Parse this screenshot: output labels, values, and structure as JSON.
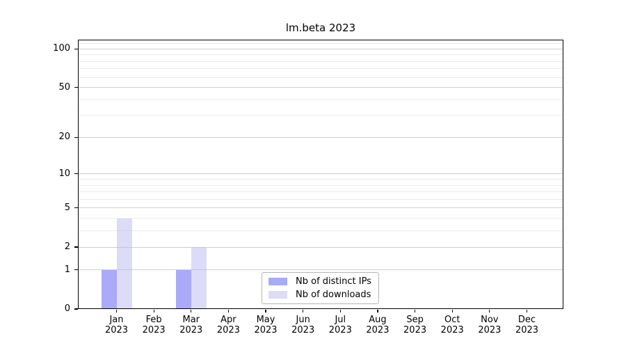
{
  "title": "lm.beta 2023",
  "chart_data": {
    "type": "bar",
    "title": "lm.beta 2023",
    "y_scale": "log1p",
    "categories": [
      "Jan",
      "Feb",
      "Mar",
      "Apr",
      "May",
      "Jun",
      "Jul",
      "Aug",
      "Sep",
      "Oct",
      "Nov",
      "Dec"
    ],
    "category_year": "2023",
    "series": [
      {
        "name": "Nb of distinct IPs",
        "color": "#aaaaf8",
        "values": [
          1,
          0,
          1,
          0,
          0,
          0,
          0,
          0,
          0,
          0,
          0,
          0
        ]
      },
      {
        "name": "Nb of downloads",
        "color": "#dcdcf8",
        "values": [
          4,
          0,
          2,
          0,
          0,
          0,
          0,
          0,
          0,
          0,
          0,
          0
        ]
      }
    ],
    "y_ticks": [
      0,
      1,
      2,
      5,
      10,
      20,
      50,
      100
    ],
    "y_minor_gridlines": [
      3,
      4,
      6,
      7,
      8,
      9,
      30,
      40,
      60,
      70,
      80,
      90,
      110
    ],
    "ylim": [
      0,
      118
    ],
    "grid": true,
    "legend_position": "lower center",
    "colors": {
      "grid_major": "#cfcfcf",
      "grid_minor": "#ebebeb",
      "axis": "#000000",
      "legend_border": "#b5b5b5",
      "background": "#ffffff",
      "text": "#000000"
    }
  }
}
